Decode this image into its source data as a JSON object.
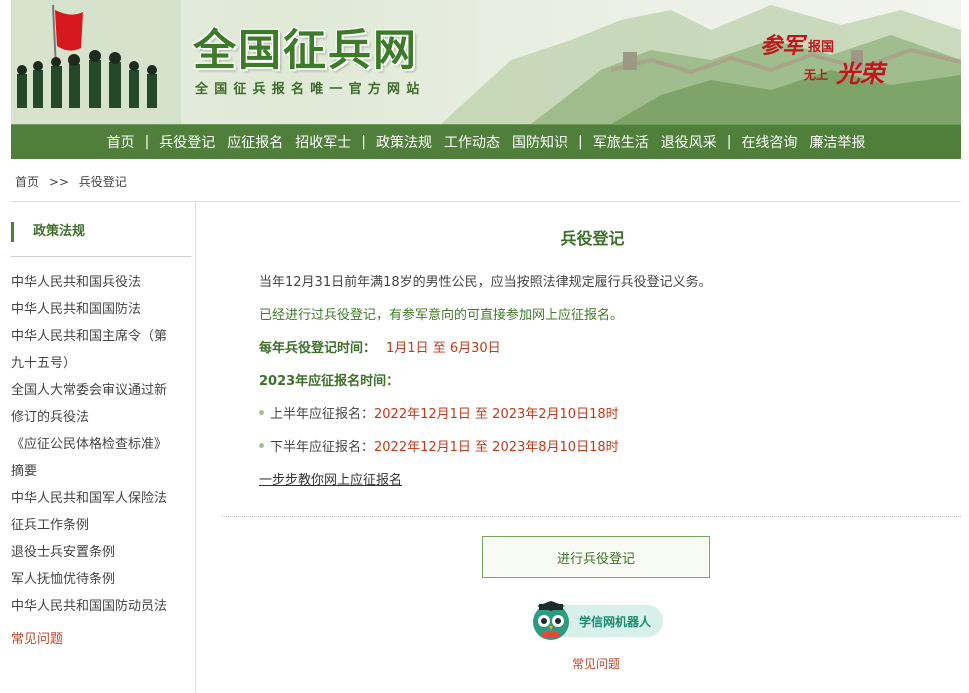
{
  "banner": {
    "title": "全国征兵网",
    "subtitle": "全国征兵报名唯一官方网站",
    "slogan": {
      "a": "参军",
      "b": "报国",
      "c": "无上",
      "d": "光荣"
    }
  },
  "nav": {
    "items": [
      "首页",
      "兵役登记",
      "应征报名",
      "招收军士",
      "政策法规",
      "工作动态",
      "国防知识",
      "军旅生活",
      "退役风采",
      "在线咨询",
      "廉洁举报"
    ],
    "separator": "|"
  },
  "breadcrumb": {
    "home": "首页",
    "sep": ">>",
    "current": "兵役登记"
  },
  "sidebar": {
    "heading": "政策法规",
    "items": [
      "中华人民共和国兵役法",
      "中华人民共和国国防法",
      "中华人民共和国主席令（第",
      "九十五号）",
      "全国人大常委会审议通过新",
      "修订的兵役法",
      "《应征公民体格检查标准》",
      "摘要",
      "中华人民共和国军人保险法",
      "征兵工作条例",
      "退役士兵安置条例",
      "军人抚恤优待条例",
      "中华人民共和国国防动员法"
    ],
    "faq": "常见问题"
  },
  "main": {
    "title": "兵役登记",
    "p1": "当年12月31日前年满18岁的男性公民，应当按照法律规定履行兵役登记义务。",
    "p2": "已经进行过兵役登记，有参军意向的可直接参加网上应征报名。",
    "reg_time_label": "每年兵役登记时间：",
    "reg_time_value": "1月1日 至 6月30日",
    "enlist_label": "2023年应征报名时间：",
    "first_half_label": "上半年应征报名：",
    "first_half_value": "2022年12月1日 至 2023年2月10日18时",
    "second_half_label": "下半年应征报名：",
    "second_half_value": "2022年12月1日 至 2023年8月10日18时",
    "guide_link": "一步步教你网上应征报名",
    "register_button": "进行兵役登记",
    "robot_label": "学信网机器人",
    "faq_link": "常见问题"
  },
  "colors": {
    "nav_green": "#4f7f3b",
    "title_green": "#3f6f2c",
    "highlight_red": "#c0391a"
  }
}
